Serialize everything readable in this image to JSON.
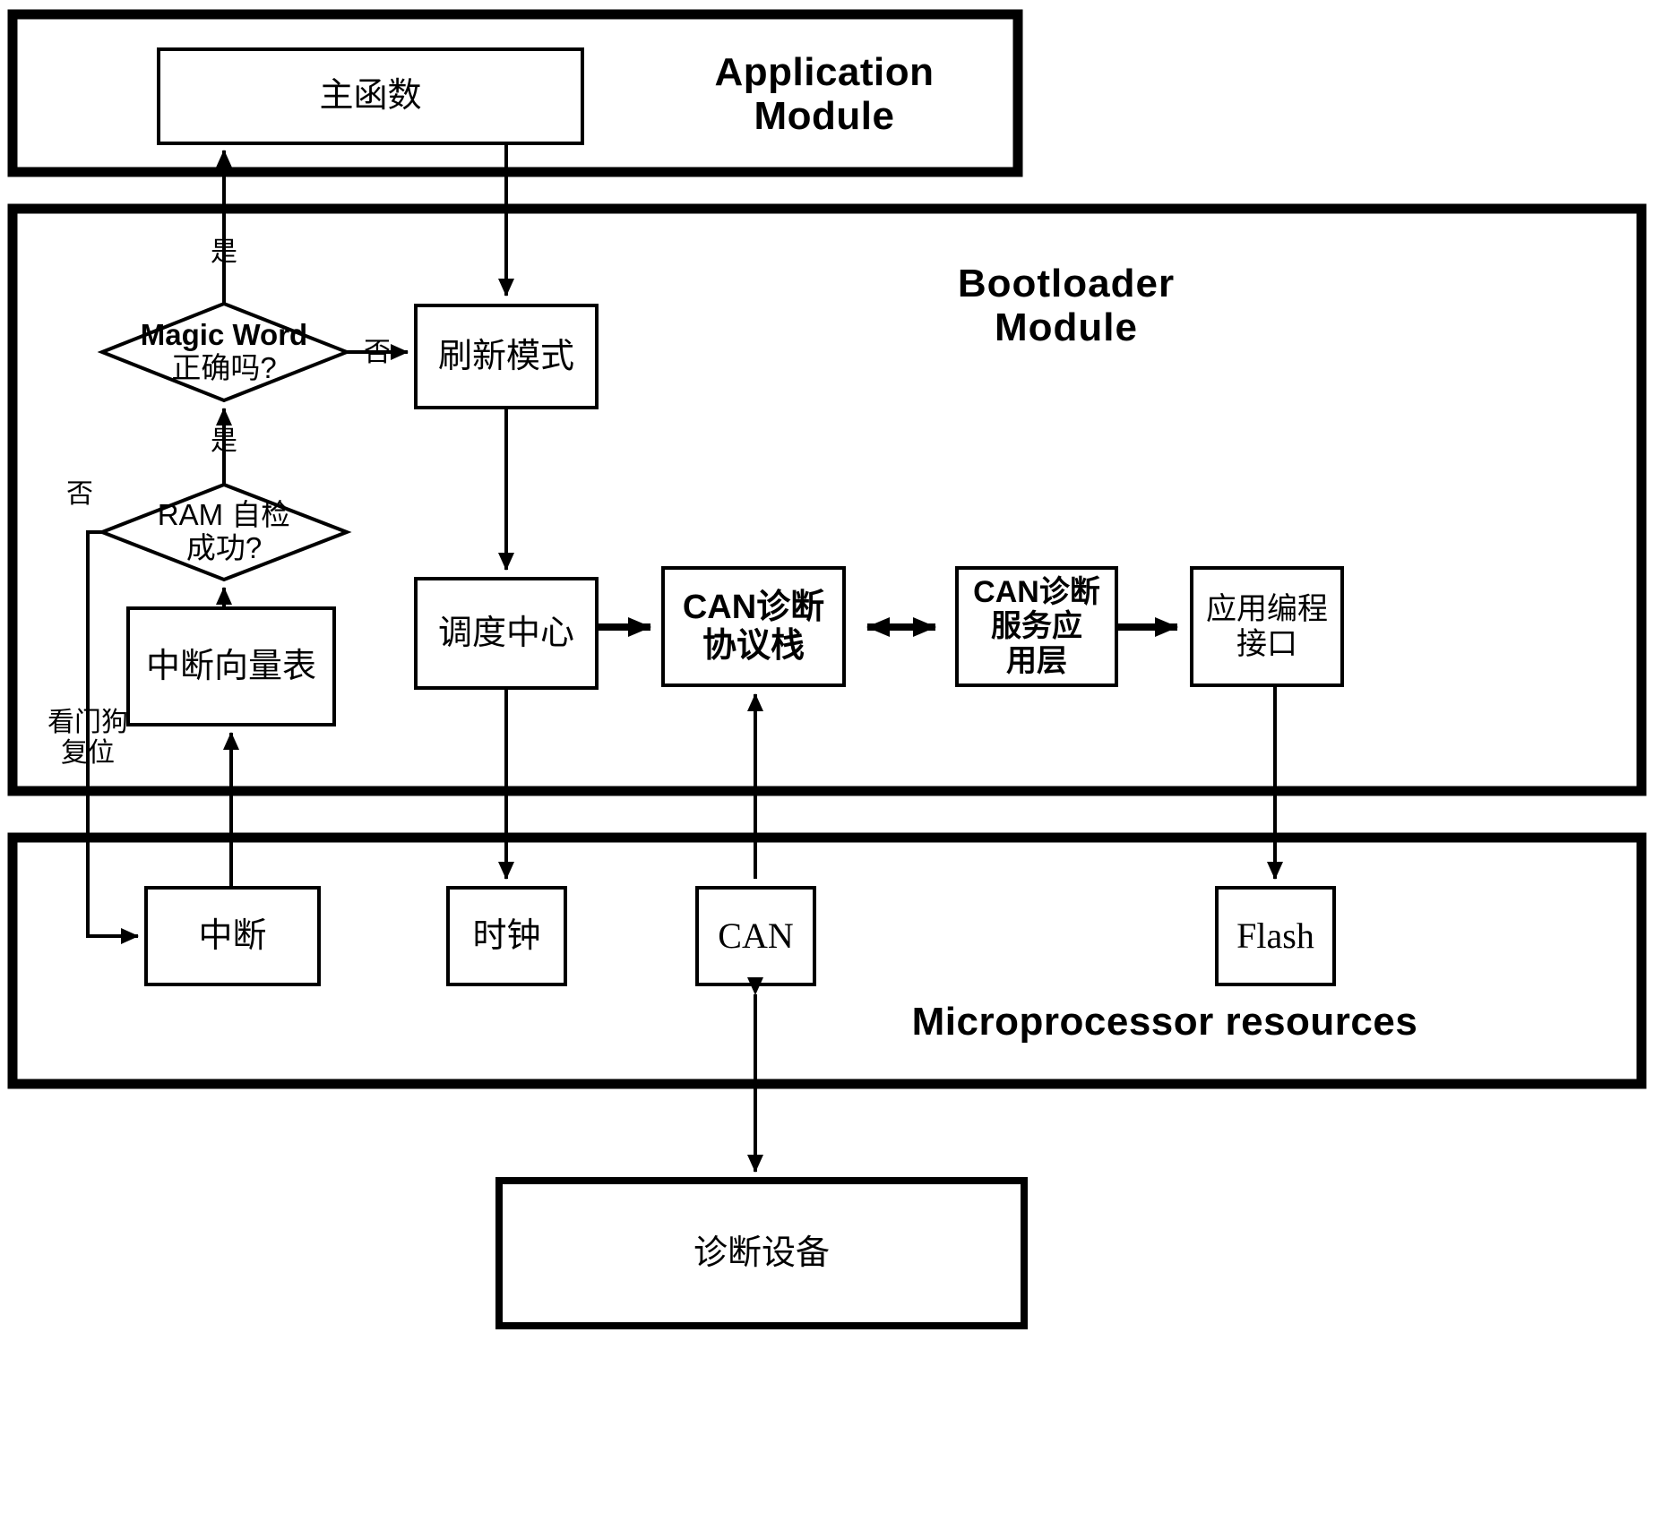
{
  "diagram": {
    "title": "Bootloader architecture block diagram",
    "background_color": "#ffffff",
    "line_color": "#000000",
    "sections": {
      "application": {
        "title": "Application Module"
      },
      "bootloader": {
        "title": "Bootloader  Module"
      },
      "microprocessor": {
        "title": "Microprocessor resources"
      }
    },
    "boxes": {
      "main_function": "主函数",
      "refresh_mode": "刷新模式",
      "interrupt_vector_table": "中断向量表",
      "scheduling_center": "调度中心",
      "can_diag_protocol_stack": "CAN诊断\n协议栈",
      "can_diag_service_app_layer": "CAN诊断\n服务应\n用层",
      "application_programming_interface": "应用编程\n接口",
      "interrupt": "中断",
      "clock": "时钟",
      "can": "CAN",
      "flash": "Flash",
      "diagnostic_device": "诊断设备"
    },
    "decisions": {
      "magic_word": {
        "line1": "Magic Word",
        "line2": "正确吗?"
      },
      "ram_selftest": {
        "line1": "RAM 自检",
        "line2": "成功?"
      }
    },
    "edge_labels": {
      "magic_word_yes": "是",
      "magic_word_no": "否",
      "ram_yes": "是",
      "ram_no": "否",
      "watchdog_reset": "看门狗\n复位"
    }
  }
}
